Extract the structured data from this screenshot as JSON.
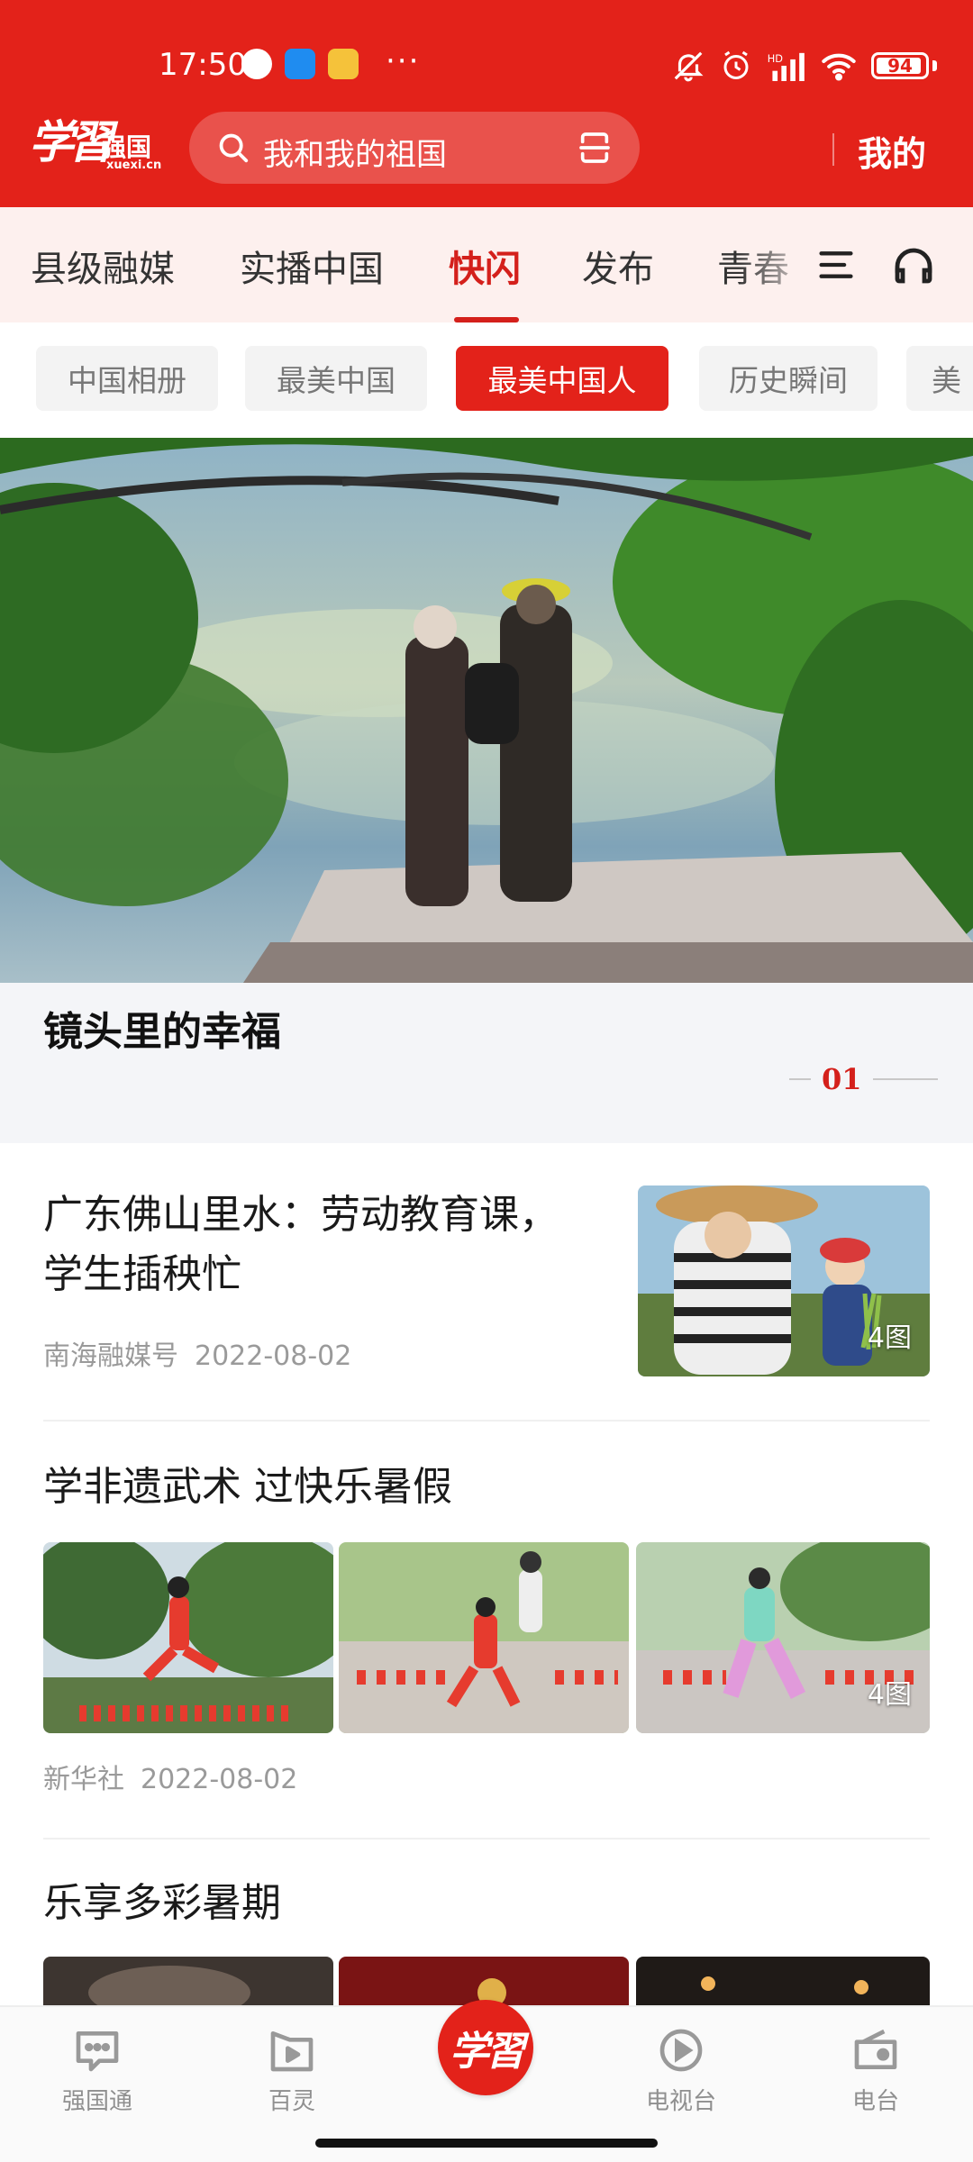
{
  "status_bar": {
    "time": "17:50",
    "more": "···",
    "battery": "94",
    "battery_level": 0.94,
    "icons": [
      "app-face-icon",
      "cloud-app-icon",
      "news-app-icon",
      "mute-icon",
      "alarm-icon",
      "signal-icon",
      "wifi-icon",
      "battery-icon"
    ]
  },
  "header": {
    "logo_script": "学習",
    "logo_text": "强国",
    "logo_sub": "xuexi.cn",
    "search_placeholder": "我和我的祖国",
    "mine": "我的"
  },
  "channels": {
    "items": [
      "县级融媒",
      "实播中国",
      "快闪",
      "发布",
      "青春"
    ],
    "active_index": 2
  },
  "chips": {
    "items": [
      "中国相册",
      "最美中国",
      "最美中国人",
      "历史瞬间",
      "美"
    ],
    "active_index": 2
  },
  "hero": {
    "title": "镜头里的幸福",
    "pager": "01"
  },
  "articles": [
    {
      "title_lines": [
        "广东佛山里水：劳动教育课，",
        "学生插秧忙"
      ],
      "source": "南海融媒号",
      "date": "2022-08-02",
      "image_count": "4图"
    },
    {
      "title": "学非遗武术 过快乐暑假",
      "source": "新华社",
      "date": "2022-08-02",
      "image_count": "4图"
    },
    {
      "title": "乐享多彩暑期"
    }
  ],
  "bottom_nav": {
    "items": [
      "强国通",
      "百灵",
      "",
      "电视台",
      "电台"
    ],
    "center_label": "学習"
  },
  "colors": {
    "brand_red": "#e3221a",
    "active_red": "#d4201b"
  }
}
